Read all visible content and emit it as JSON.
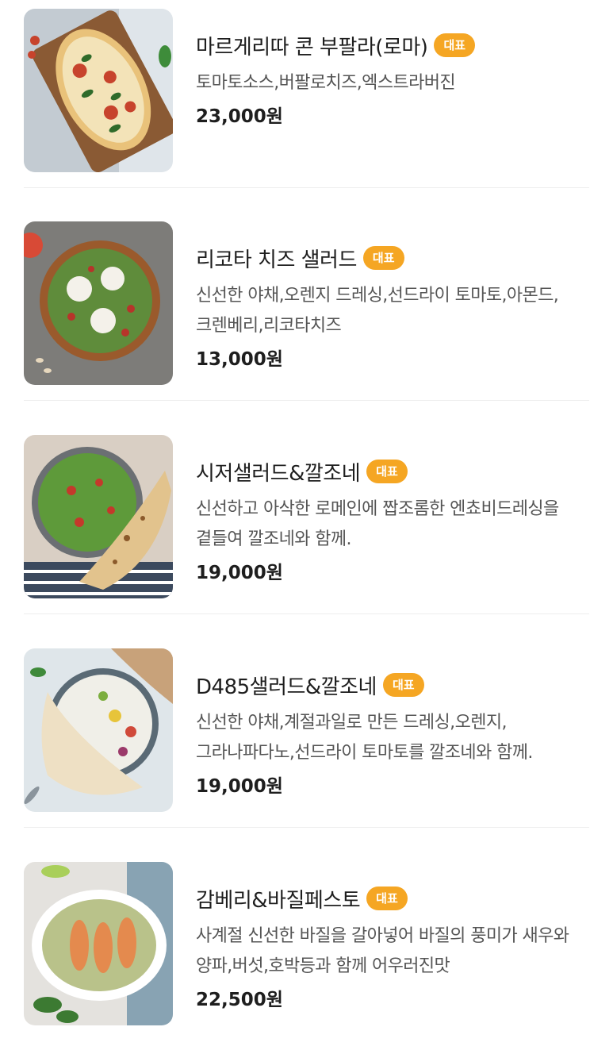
{
  "menu": {
    "badge_label": "대표",
    "items": [
      {
        "name": "마르게리따 콘 부팔라(로마)",
        "description": "토마토소스,버팔로치즈,엑스트라버진",
        "price": "23,000원",
        "image": "margherita-pizza-image"
      },
      {
        "name": "리코타 치즈 샐러드",
        "description": "신선한 야채,오렌지 드레싱,선드라이 토마토,아몬드,크렌베리,리코타치즈",
        "price": "13,000원",
        "image": "ricotta-salad-image"
      },
      {
        "name": "시저샐러드&깔조네",
        "description": "신선하고 아삭한 로메인에 짭조롬한 엔쵸비드레싱을 곁들여 깔조네와 함께.",
        "price": "19,000원",
        "image": "caesar-salad-calzone-image"
      },
      {
        "name": "D485샐러드&깔조네",
        "description": "신선한 야채,계절과일로 만든 드레싱,오렌지,그라나파다노,선드라이 토마토를 깔조네와 함께.",
        "price": "19,000원",
        "image": "d485-salad-calzone-image"
      },
      {
        "name": "감베리&바질페스토",
        "description": "사계절 신선한 바질을 갈아넣어 바질의 풍미가 새우와 양파,버섯,호박등과 함께 어우러진맛",
        "price": "22,500원",
        "image": "gamberi-basil-pesto-image"
      }
    ]
  }
}
